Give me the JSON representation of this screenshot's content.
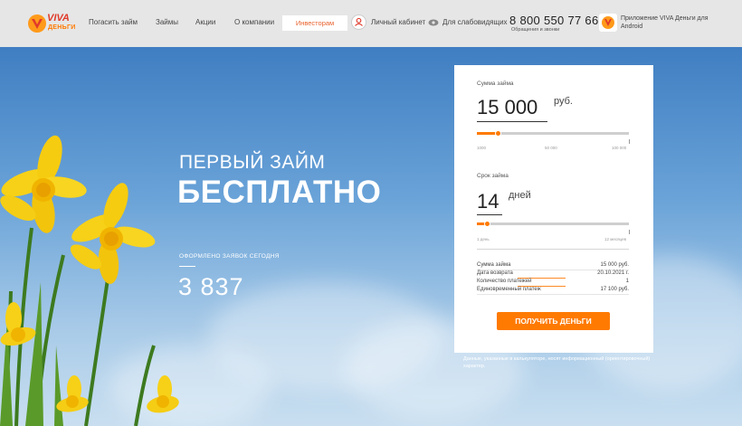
{
  "header": {
    "logo": {
      "top": "VIVA",
      "bottom": "ДЕНЬГИ"
    },
    "nav": [
      {
        "label": "Погасить займ"
      },
      {
        "label": "Займы"
      },
      {
        "label": "Акции"
      },
      {
        "label": "О компании"
      }
    ],
    "investors_label": "Инвесторам",
    "cabinet_label": "Личный кабинет",
    "accessibility_label": "Для слабовидящих",
    "phone": "8 800 550 77 66",
    "phone_note": "Обращения и звонки",
    "app_label": "Приложение VIVA Деньги для Android"
  },
  "hero": {
    "headline_1": "ПЕРВЫЙ ЗАЙМ",
    "headline_2": "БЕСПЛАТНО",
    "count_label": "ОФОРМЛЕНО ЗАЯВОК СЕГОДНЯ",
    "count_value": "3 837"
  },
  "calculator": {
    "amount_label": "Сумма займа",
    "amount_value": "15 000",
    "amount_unit": "руб.",
    "amount_fraction": 0.14,
    "amount_ticks": [
      "1000",
      "50 000",
      "100 000"
    ],
    "term_label": "Срок займа",
    "term_value": "14",
    "term_unit": "дней",
    "term_fraction": 0.07,
    "term_ticks": [
      "1 день",
      "12 месяцев"
    ],
    "summary": [
      {
        "key": "Сумма займа",
        "value": "15 000 руб."
      },
      {
        "key": "Дата возврата",
        "value": "20.10.2021 г."
      },
      {
        "key": "Количество платежей",
        "value": "1"
      },
      {
        "key": "Единовременный платеж",
        "value": "17 100 руб."
      }
    ],
    "cta_label": "ПОЛУЧИТЬ ДЕНЬГИ"
  },
  "disclaimer": "Данные, указанные в калькуляторе, носят информационный (ориентировочный) характер.",
  "colors": {
    "accent": "#ff7a00",
    "logo_red": "#e03a2b",
    "header_bg": "#e6e6e6"
  }
}
